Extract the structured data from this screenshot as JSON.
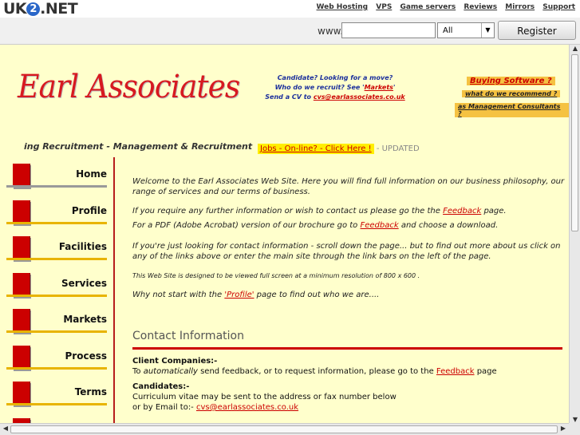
{
  "site": {
    "logo_pre": "UK",
    "logo_mid": "2",
    "logo_post": ".NET",
    "links": [
      "Web Hosting",
      "VPS",
      "Game servers",
      "Reviews",
      "Mirrors",
      "Support"
    ]
  },
  "domain_bar": {
    "www_label": "www.",
    "input_value": "",
    "select_value": "All",
    "register_label": "Register Domain"
  },
  "header": {
    "brand": "Earl Associates",
    "candidate_line1": "Candidate? Looking for a move?",
    "candidate_line2_pre": "Who do we recruit? See '",
    "candidate_markets": "Markets",
    "candidate_line2_post": "'",
    "candidate_line3_pre": "Send a CV to ",
    "candidate_email": "cvs@earlassociates.co.uk",
    "buying_software": "Buying Software ?",
    "what_recommend": "what do we recommend ?",
    "as_consultants": "as Management Consultants ?",
    "tagline": "ing Recruitment - Management & Recruitment",
    "jobs_link": "Jobs - On-line? - Click Here !",
    "jobs_updated": "- UPDATED"
  },
  "nav": {
    "items": [
      "Home",
      "Profile",
      "Facilities",
      "Services",
      "Markets",
      "Process",
      "Terms"
    ]
  },
  "content": {
    "welcome": "Welcome to the Earl Associates Web Site. Here you will find full information on our business philosophy, our range of services and our terms of business.",
    "further_pre": "If you require any further information or wish to contact us please go the the ",
    "feedback": "Feedback",
    "further_post": " page.",
    "pdf_pre": "For a PDF (Adobe Acrobat) version of our brochure go to ",
    "pdf_post": " and choose a download.",
    "looking": "If you're just looking for contact information - scroll down the page... but to find out more about us click on any of the links above or enter the main site through the link bars on the left of the page.",
    "resolution": "This Web Site is designed to be viewed full screen at a minimum resolution of 800 x 600 .",
    "start_pre": "Why not start with the ",
    "start_link": "'Profile'",
    "start_post": " page to find out who we are....",
    "contact_heading": "Contact Information",
    "client_heading": "Client Companies:-",
    "client_pre": "To ",
    "client_auto": "automatically",
    "client_mid": " send feedback, or to request information, please go to the ",
    "client_post": " page",
    "cand_heading": "Candidates:-",
    "cand_line1": "Curriculum vitae may be sent to the address or fax number below",
    "cand_line2_pre": "or by Email to:- ",
    "cand_email": "cvs@earlassociates.co.uk"
  },
  "colors": {
    "page_bg": "#ffffcc",
    "accent_red": "#cc0000",
    "link_blue": "#1b2f9c",
    "highlight": "#f5c242"
  }
}
